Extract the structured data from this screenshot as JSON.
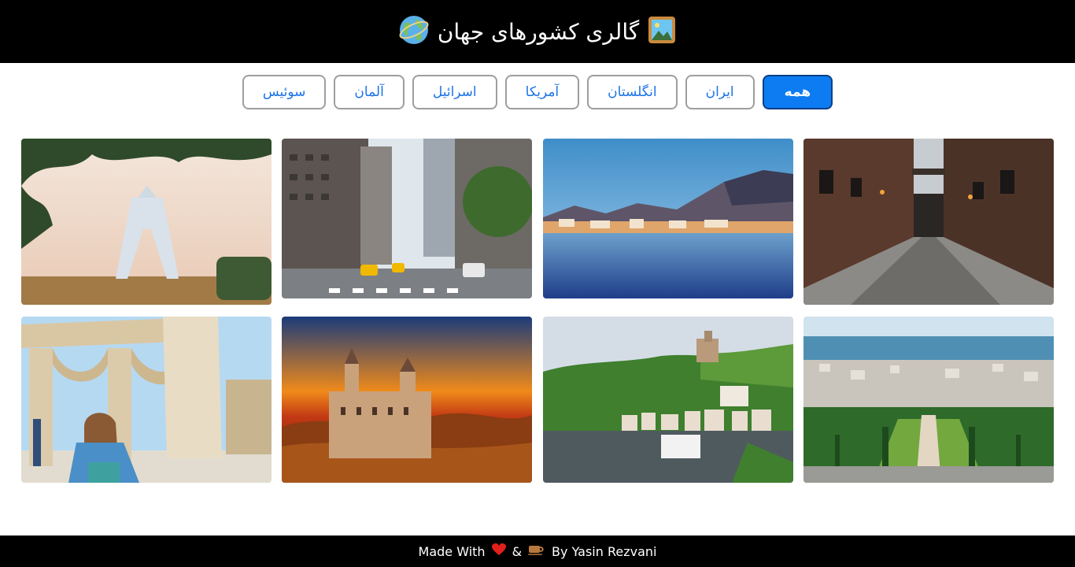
{
  "header": {
    "title": "گالری کشورهای جهان",
    "title_icon": "picture-frame-icon",
    "globe_icon": "globe-icon"
  },
  "filters": [
    {
      "label": "همه",
      "active": true
    },
    {
      "label": "ایران",
      "active": false
    },
    {
      "label": "انگلستان",
      "active": false
    },
    {
      "label": "آمریکا",
      "active": false
    },
    {
      "label": "اسرائیل",
      "active": false
    },
    {
      "label": "آلمان",
      "active": false
    },
    {
      "label": "سوئیس",
      "active": false
    }
  ],
  "gallery": {
    "images": [
      {
        "subject": "azadi-tower-tehran",
        "country": "ایران"
      },
      {
        "subject": "new-york-street",
        "country": "آمریکا"
      },
      {
        "subject": "swiss-lake-town",
        "country": "سوئیس"
      },
      {
        "subject": "london-brick-alley",
        "country": "انگلستان"
      },
      {
        "subject": "stone-arches-jerusalem",
        "country": "اسرائیل"
      },
      {
        "subject": "neuschwanstein-castle-sunset",
        "country": "آلمان"
      },
      {
        "subject": "cochem-castle-river",
        "country": "آلمان"
      },
      {
        "subject": "haifa-bahai-gardens",
        "country": "اسرائیل"
      }
    ]
  },
  "footer": {
    "made_with": "Made With",
    "ampersand": "&",
    "author": "By Yasin Rezvani",
    "heart_icon": "heart-icon",
    "coffee_icon": "coffee-icon"
  },
  "colors": {
    "header_bg": "#000000",
    "accent": "#0d7cf2",
    "link_text": "#1a73e8",
    "heart": "#e0201b"
  }
}
